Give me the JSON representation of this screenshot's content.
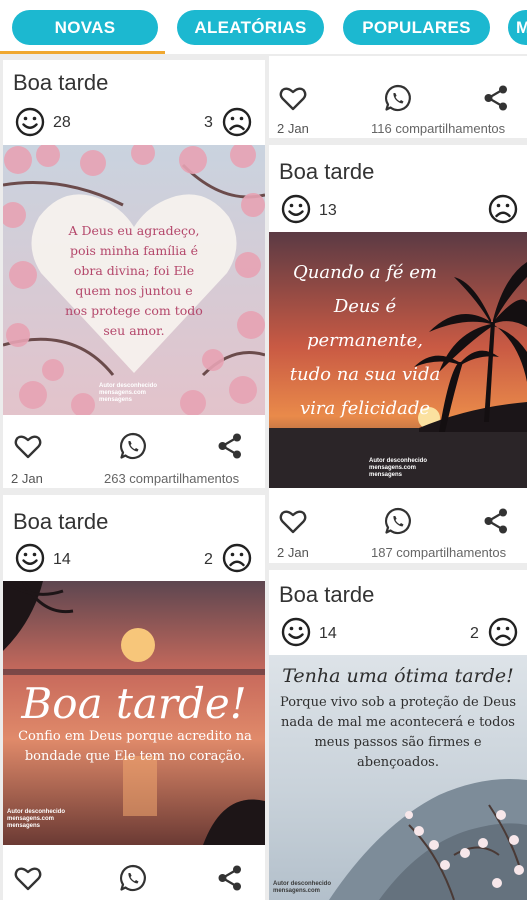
{
  "tabs": [
    "NOVAS",
    "ALEATÓRIAS",
    "POPULARES",
    "M"
  ],
  "colors": {
    "accent": "#1cb8d0",
    "indicator": "#f0a830"
  },
  "icons": {
    "happy": "smile-face-icon",
    "sad": "sad-face-icon",
    "like": "heart-icon",
    "whatsapp": "whatsapp-icon",
    "share": "share-icon"
  },
  "cards": [
    {
      "title": "Boa tarde",
      "likes": "28",
      "dislikes": "3",
      "date": "2 Jan",
      "shares": "263 compartilhamentos",
      "quote": "A Deus eu agradeço, pois minha família é obra divina; foi Ele quem nos juntou e nos protege com todo seu amor.",
      "footer": "Autor desconhecido\nmensagens.com\nmensagens"
    },
    {
      "title": "Boa tarde",
      "likes": "14",
      "dislikes": "2",
      "quote_title": "Boa tarde!",
      "quote": "Confio em Deus porque acredito na bondade que Ele tem no coração.",
      "footer": "Autor desconhecido\nmensagens.com\nmensagens"
    },
    {
      "date": "2 Jan",
      "shares": "116 compartilhamentos"
    },
    {
      "title": "Boa tarde",
      "likes": "13",
      "dislikes": "",
      "date": "2 Jan",
      "shares": "187 compartilhamentos",
      "quote": "Quando a fé em Deus é permanente, tudo na sua vida vira felicidade",
      "footer": "Autor desconhecido\nmensagens.com\nmensagens"
    },
    {
      "title": "Boa tarde",
      "likes": "14",
      "dislikes": "2",
      "quote_title": "Tenha uma ótima tarde!",
      "quote": "Porque vivo sob a proteção de Deus nada de mal me acontecerá e todos meus passos são firmes e abençoados.",
      "footer": "Autor desconhecido\nmensagens.com"
    }
  ]
}
